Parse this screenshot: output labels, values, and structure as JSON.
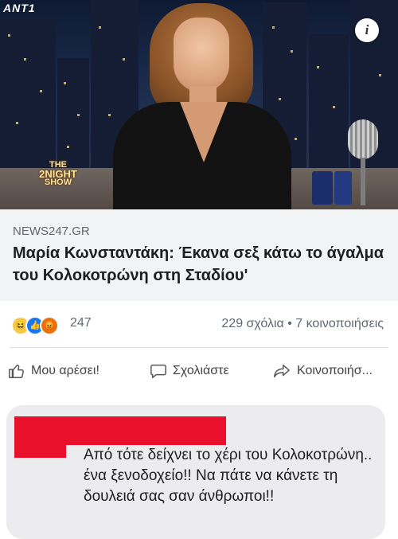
{
  "hero": {
    "channel_logo": "ANT1",
    "show_logo_top": "THE",
    "show_logo_mid": "2NIGHT",
    "show_logo_bottom": "SHOW",
    "info_icon": "i"
  },
  "preview": {
    "domain": "NEWS247.GR",
    "headline": "Μαρία Κωνσταντάκη: Έκανα σεξ κάτω το άγαλμα του Κολοκοτρώνη στη Σταδίου'"
  },
  "reactions": {
    "icons": [
      "haha-icon",
      "like-icon",
      "angry-icon"
    ],
    "count": "247",
    "comments_shares": "229 σχόλια • 7 κοινοποιήσεις"
  },
  "actions": {
    "like_label": "Μου αρέσει!",
    "comment_label": "Σχολιάστε",
    "share_label": "Κοινοποιήσ..."
  },
  "comment": {
    "text": "Από τότε δείχνει το χέρι του Κολοκοτρώνη.. ένα ξενοδοχείο!! Να πάτε να κάνετε τη δουλειά σας σαν άνθρωποι!!"
  },
  "colors": {
    "link_blue": "#1877f2",
    "redaction": "#e8102a",
    "preview_bg": "#f2f3f5"
  }
}
